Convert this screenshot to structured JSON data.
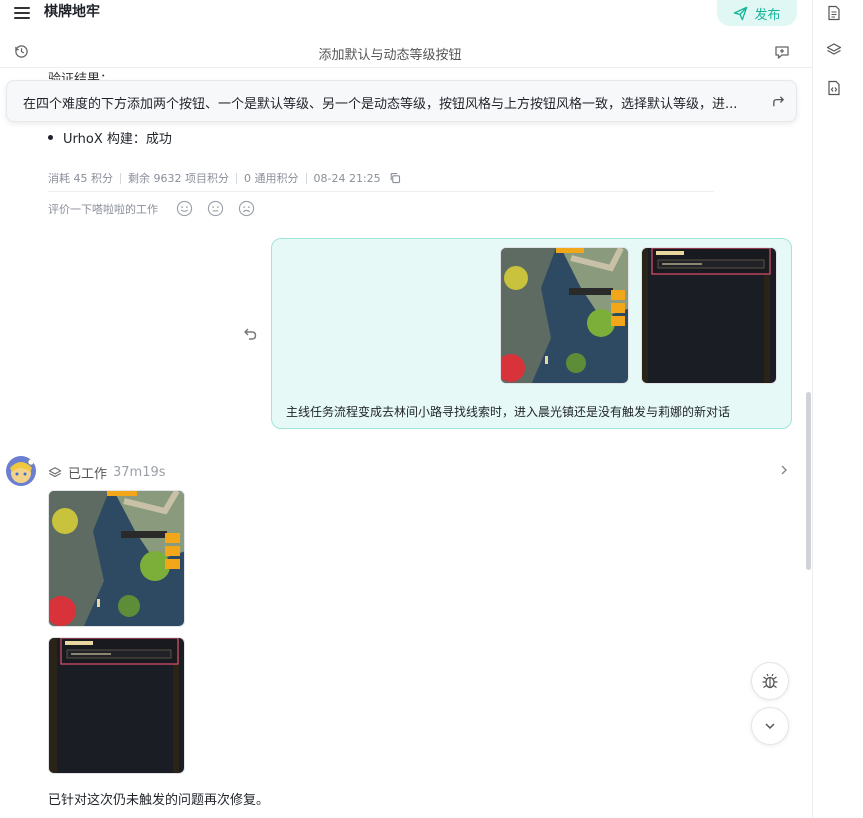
{
  "header": {
    "app_title": "棋牌地牢",
    "publish_label": "发布",
    "conversation_title": "添加默认与动态等级按钮"
  },
  "banner": {
    "text": "在四个难度的下方添加两个按钮、一个是默认等级、另一个是动态等级，按钮风格与上方按钮风格一致，选择默认等级，进..."
  },
  "previous_reply": {
    "peek_text": "验证结果：",
    "bullet": "UrhoX 构建：成功",
    "meta": {
      "cost": "消耗 45 积分",
      "remaining": "剩余 9632 项目积分",
      "general": "0 通用积分",
      "time": "08-24 21:25"
    },
    "rate_prompt": "评价一下嗒啦啦的工作"
  },
  "user_message": {
    "text": "主线任务流程变成去林间小路寻找线索时，进入晨光镇还是没有触发与莉娜的新对话"
  },
  "agent": {
    "status_label": "已工作",
    "duration": "37m19s",
    "reply_text": "已针对这次仍未触发的问题再次修复。"
  },
  "colors": {
    "accent": "#13b59a",
    "bubble_bg": "#e6f9f6",
    "bubble_border": "#9fe6d8"
  },
  "icons": [
    "menu-icon",
    "send-icon",
    "history-icon",
    "chat-add-icon",
    "document-icon",
    "layers-icon",
    "code-file-icon",
    "redo-arrow-icon",
    "copy-icon",
    "smile-icon",
    "neutral-icon",
    "sad-icon",
    "undo-icon",
    "chevron-right-icon",
    "bug-icon",
    "chevron-down-icon"
  ]
}
